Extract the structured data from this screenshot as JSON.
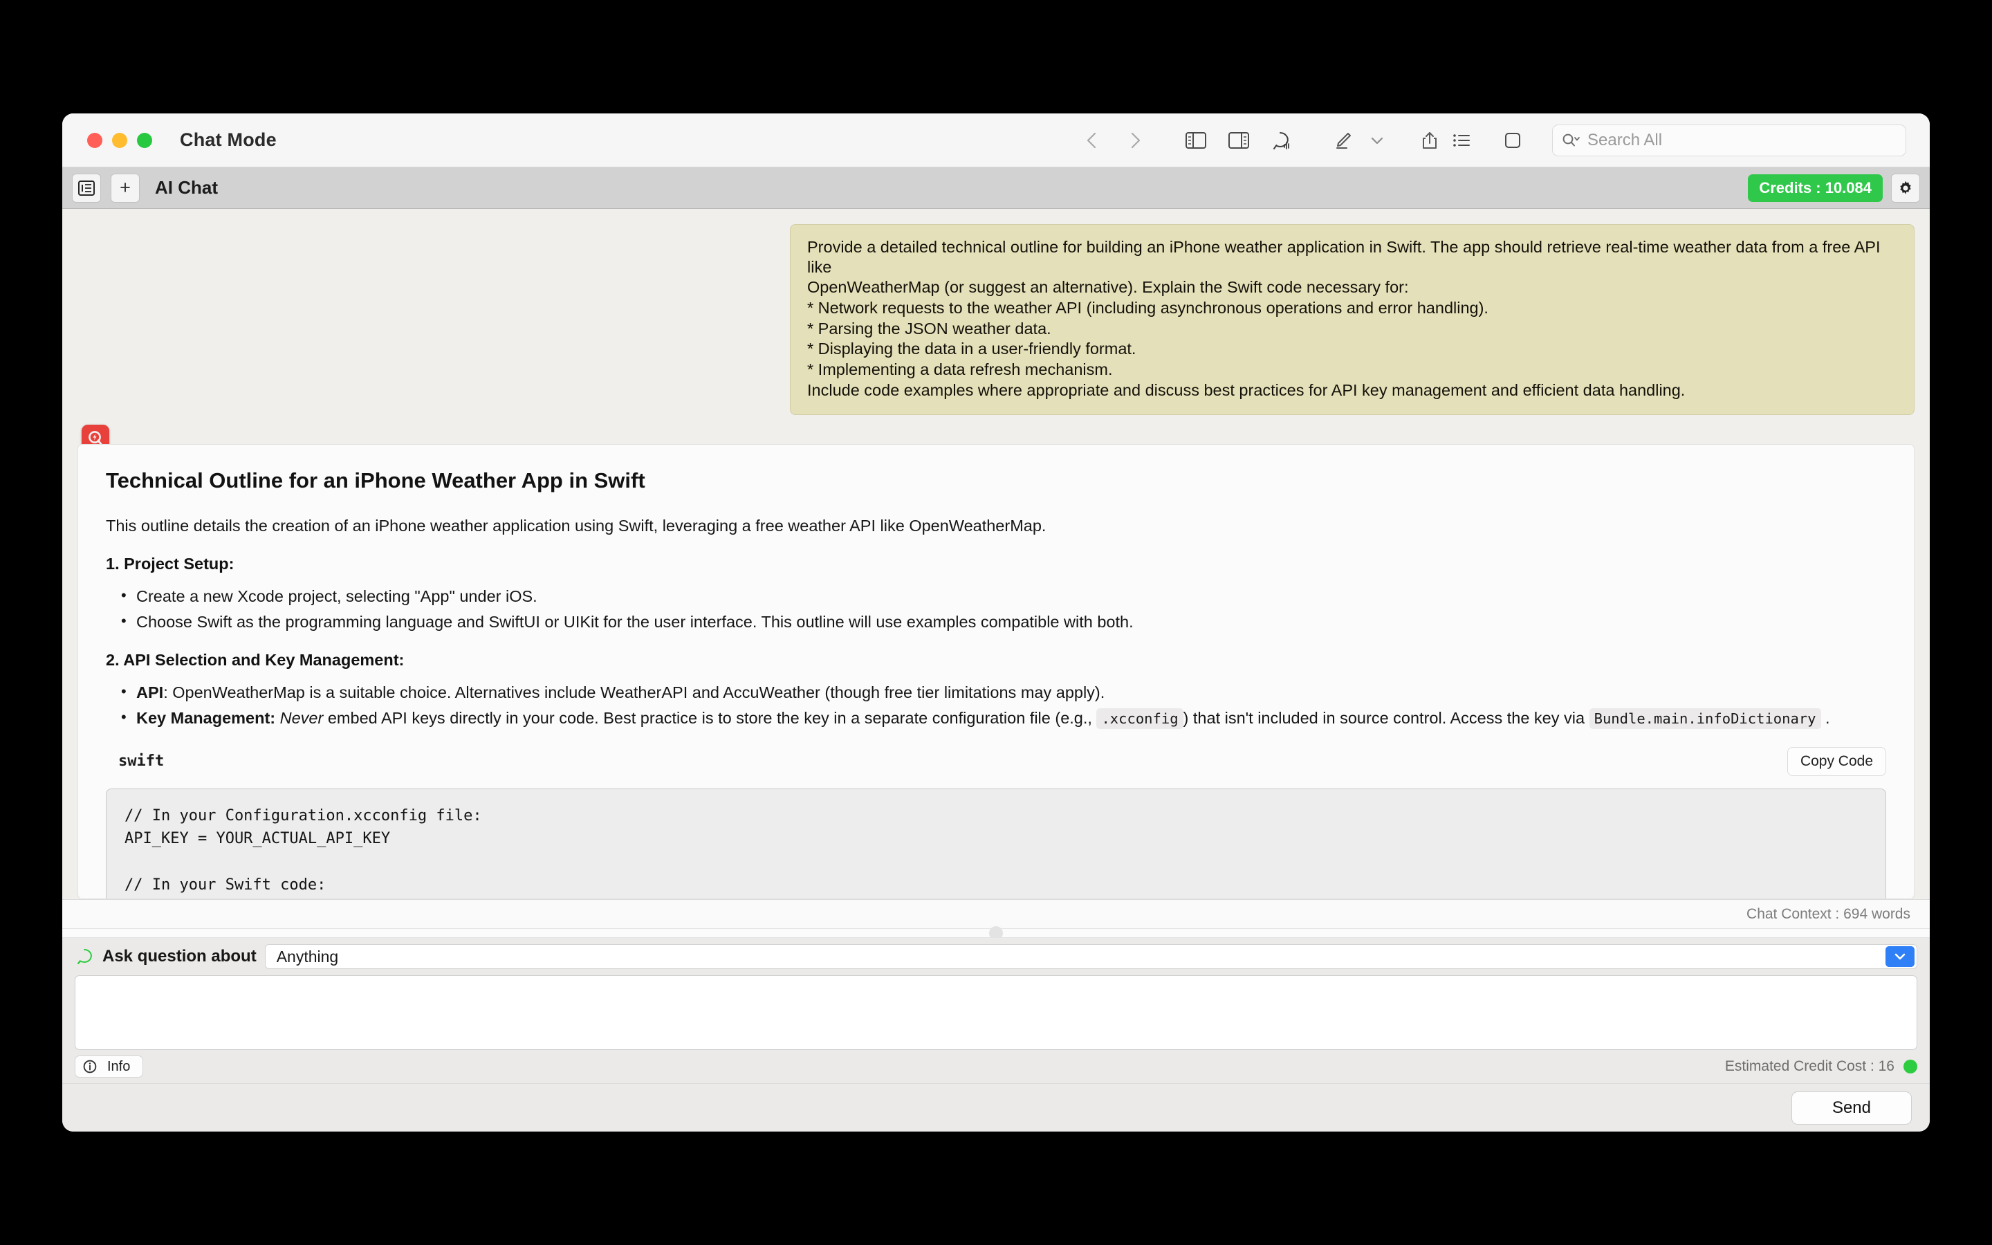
{
  "window": {
    "title": "Chat Mode",
    "traffic_lights": [
      "close",
      "minimize",
      "zoom"
    ]
  },
  "toolbar": {
    "icons": [
      "back-chevron",
      "forward-chevron",
      "left-sidebar-toggle",
      "right-sidebar-toggle",
      "chat-waveform",
      "highlighter-pen",
      "chevron-down",
      "share-export",
      "list-view",
      "square-view"
    ],
    "search_placeholder": "Search All"
  },
  "chat_header": {
    "list_icon": "list-panel-icon",
    "new_chat_label": "+",
    "title": "AI Chat",
    "credits_label": "Credits : 10.084",
    "credits_color": "#30c84b",
    "settings_icon": "gear-icon"
  },
  "conversation": {
    "user_message": {
      "bubble_color": "#e4e0b9",
      "lines": [
        "Provide a detailed technical outline for building an iPhone weather application in Swift. The app should retrieve real-time weather data from a free API like",
        "OpenWeatherMap (or suggest an alternative). Explain the Swift code necessary for:",
        "* Network requests to the weather API (including asynchronous operations and error handling).",
        "* Parsing the JSON weather data.",
        "* Displaying the data in a user-friendly format.",
        "* Implementing a data refresh mechanism.",
        "Include code examples where appropriate and discuss best practices for API key management and efficient data handling."
      ]
    },
    "assistant_message": {
      "avatar_icon": "app-badge-icon",
      "avatar_color": "#e8403a",
      "heading": "Technical Outline for an iPhone Weather App in Swift",
      "intro": "This outline details the creation of an iPhone weather application using Swift, leveraging a free weather API like OpenWeatherMap.",
      "section1_title": "1. Project Setup:",
      "section1_bullets": [
        "Create a new Xcode project, selecting \"App\" under iOS.",
        "Choose Swift as the programming language and SwiftUI or UIKit for the user interface. This outline will use examples compatible with both."
      ],
      "section2_title": "2. API Selection and Key Management:",
      "bullet_api_label": "API",
      "bullet_api_text": ": OpenWeatherMap is a suitable choice. Alternatives include WeatherAPI and AccuWeather (though free tier limitations may apply).",
      "bullet_key_label": "Key Management:",
      "bullet_key_em": "Never",
      "bullet_key_text_1": " embed API keys directly in your code. Best practice is to store the key in a separate configuration file (e.g.,",
      "bullet_key_code_1": ".xcconfig",
      "bullet_key_text_2": ") that isn't included in source control. Access the key via",
      "bullet_key_code_2": "Bundle.main.infoDictionary",
      "bullet_key_text_3": ".",
      "code_language": "swift",
      "copy_button": "Copy Code",
      "code": "// In your Configuration.xcconfig file:\nAPI_KEY = YOUR_ACTUAL_API_KEY\n\n// In your Swift code:\nguard let apiKey = Bundle.main.infoDictionary?[\"API_KEY\"] as? String else {\n    fatalError(\"API Key not found.\")\n}"
    }
  },
  "context_bar": {
    "text": "Chat Context : 694 words"
  },
  "composer": {
    "bubble_icon": "speech-bubble-icon",
    "bubble_icon_color": "#2ecc40",
    "ask_label": "Ask question about",
    "ask_value": "Anything",
    "ask_chevron_icon": "chevron-down-icon",
    "ask_chevron_color": "#2f80f7",
    "input_value": "",
    "info_icon": "info-circle-icon",
    "info_label": "Info",
    "credit_cost": "Estimated Credit Cost : 16",
    "status_dot_color": "#2ecc40",
    "send_label": "Send"
  }
}
